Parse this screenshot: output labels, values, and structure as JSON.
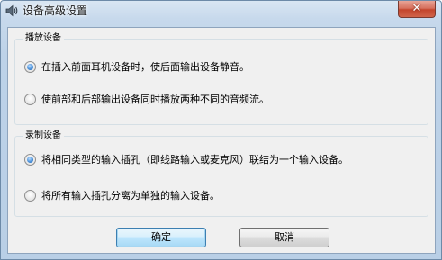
{
  "window": {
    "title": "设备高级设置",
    "close_label": "✕"
  },
  "playback": {
    "legend": "播放设备",
    "options": [
      {
        "label": "在插入前面耳机设备时，使后面输出设备静音。",
        "checked": true
      },
      {
        "label": "使前部和后部输出设备同时播放两种不同的音频流。",
        "checked": false
      }
    ]
  },
  "recording": {
    "legend": "录制设备",
    "options": [
      {
        "label": "将相同类型的输入插孔（即线路输入或麦克风）联结为一个输入设备。",
        "checked": true
      },
      {
        "label": "将所有输入插孔分离为单独的输入设备。",
        "checked": false
      }
    ]
  },
  "buttons": {
    "ok": "确定",
    "cancel": "取消"
  },
  "icons": {
    "title": "speaker-icon"
  }
}
